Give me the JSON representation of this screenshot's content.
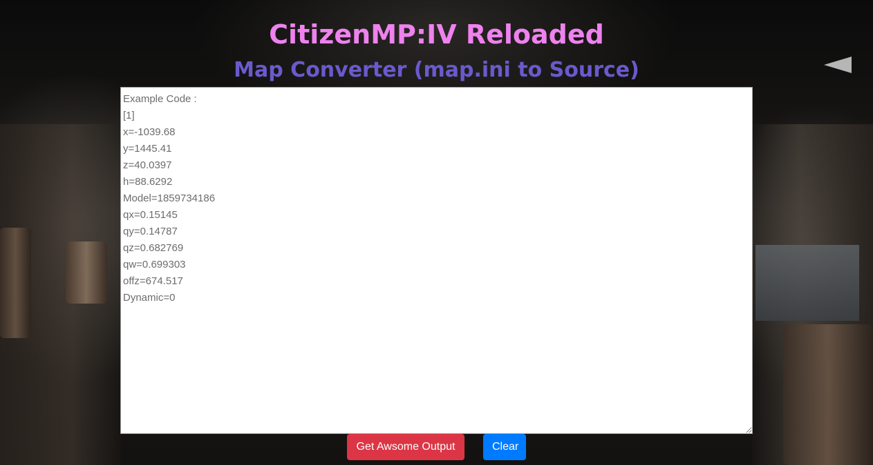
{
  "header": {
    "title": "CitizenMP:IV Reloaded",
    "subtitle": "Map Converter (map.ini to Source)"
  },
  "editor": {
    "value": "",
    "placeholder": "Example Code :\n[1]\nx=-1039.68\ny=1445.41\nz=40.0397\nh=88.6292\nModel=1859734186\nqx=0.15145\nqy=0.14787\nqz=0.682769\nqw=0.699303\noffz=674.517\nDynamic=0"
  },
  "actions": {
    "output_label": "Get Awsome Output",
    "clear_label": "Clear"
  },
  "colors": {
    "title": "#ee82ee",
    "subtitle": "#6a5acd",
    "output_button": "#dc3545",
    "clear_button": "#007bff"
  }
}
